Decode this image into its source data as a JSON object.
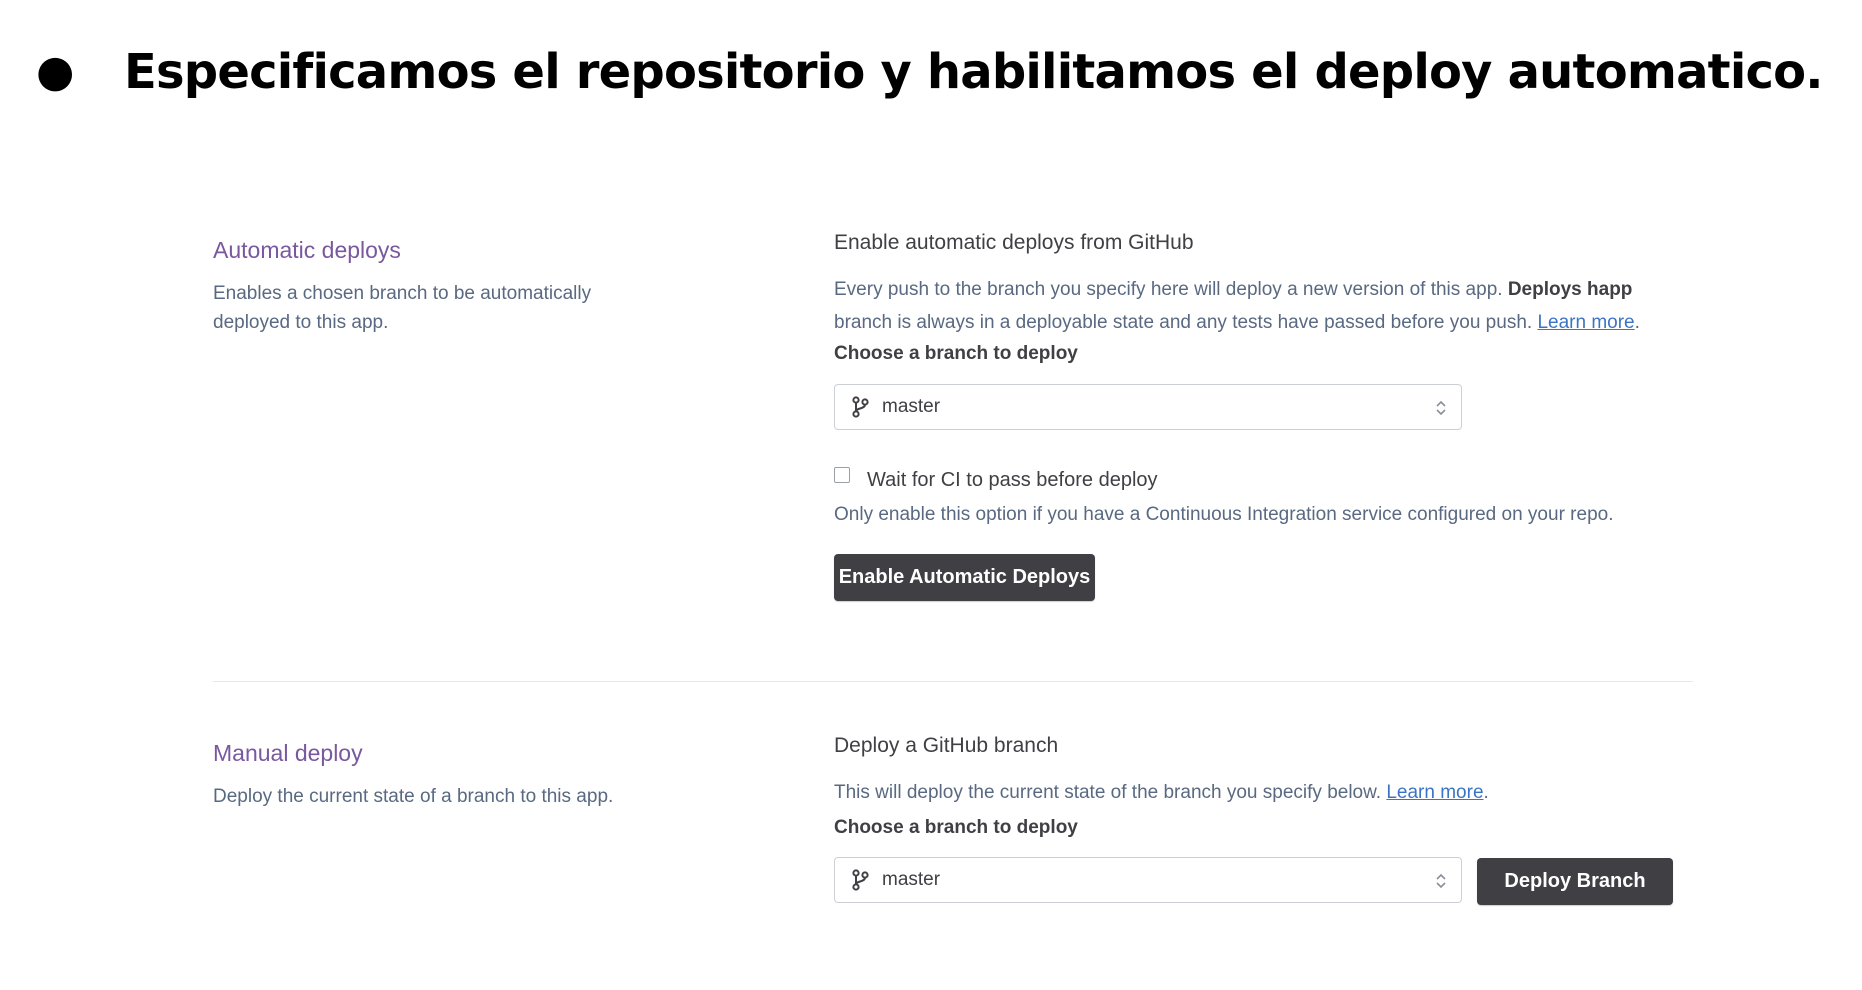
{
  "slide": {
    "bullet": "●",
    "title": "Especificamos el repositorio y habilitamos el deploy automatico."
  },
  "automatic": {
    "title": "Automatic deploys",
    "description": "Enables a chosen branch to be automatically deployed to this app.",
    "heading": "Enable automatic deploys from GitHub",
    "body_line1_prefix": "Every push to the branch you specify here will deploy a new version of this app. ",
    "body_line1_bold": "Deploys happ",
    "body_line2_prefix": "branch is always in a deployable state and any tests have passed before you push. ",
    "learn_more": "Learn more",
    "learn_more_suffix": ".",
    "choose_label": "Choose a branch to deploy",
    "branch_value": "master",
    "branch_icon": "git-branch-icon",
    "checkbox_label": "Wait for CI to pass before deploy",
    "checkbox_checked": false,
    "checkbox_help": "Only enable this option if you have a Continuous Integration service configured on your repo.",
    "button_label": "Enable Automatic Deploys"
  },
  "manual": {
    "title": "Manual deploy",
    "description": "Deploy the current state of a branch to this app.",
    "heading": "Deploy a GitHub branch",
    "body_prefix": "This will deploy the current state of the branch you specify below. ",
    "learn_more": "Learn more",
    "learn_more_suffix": ".",
    "choose_label": "Choose a branch to deploy",
    "branch_value": "master",
    "branch_icon": "git-branch-icon",
    "button_label": "Deploy Branch"
  },
  "colors": {
    "section_title": "#79589f",
    "link": "#3c74c5",
    "button": "#3f3f44"
  }
}
